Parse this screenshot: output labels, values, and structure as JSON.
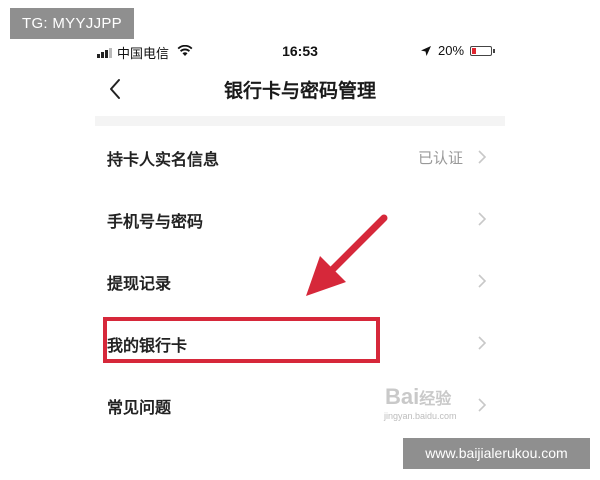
{
  "overlay": {
    "tg_label": "TG: MYYJJPP",
    "site_url": "www.baijialerukou.com"
  },
  "status_bar": {
    "carrier": "中国电信",
    "time": "16:53",
    "battery_percent": "20%",
    "icons": [
      "signal-icon",
      "wifi-icon",
      "location-icon",
      "battery-icon"
    ]
  },
  "nav": {
    "back_icon": "chevron-left-icon",
    "title": "银行卡与密码管理"
  },
  "list": {
    "items": [
      {
        "label": "持卡人实名信息",
        "value": "已认证"
      },
      {
        "label": "手机号与密码",
        "value": ""
      },
      {
        "label": "提现记录",
        "value": ""
      },
      {
        "label": "我的银行卡",
        "value": "",
        "highlighted": true
      },
      {
        "label": "常见问题",
        "value": ""
      }
    ]
  },
  "annotation": {
    "highlight_color": "#d6283a",
    "arrow_color": "#d6283a"
  },
  "watermark": {
    "brand": "Bai",
    "brand2": "经验",
    "sub": "jingyan.baidu.com"
  }
}
